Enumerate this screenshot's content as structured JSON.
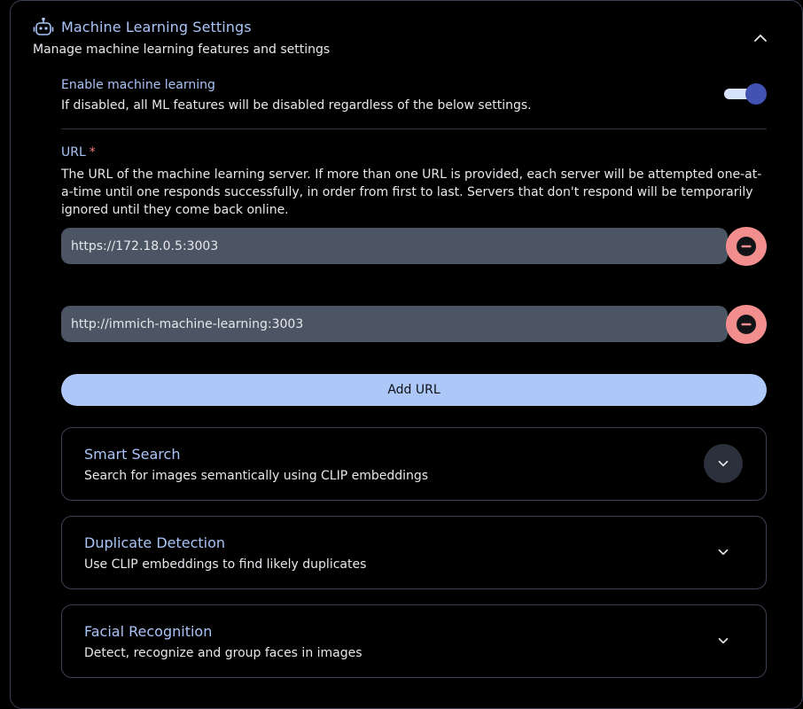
{
  "header": {
    "title": "Machine Learning Settings",
    "description": "Manage machine learning features and settings"
  },
  "enable_ml": {
    "label": "Enable machine learning",
    "description": "If disabled, all ML features will be disabled regardless of the below settings.",
    "enabled": true
  },
  "url": {
    "label": "URL",
    "required_marker": "*",
    "description": "The URL of the machine learning server. If more than one URL is provided, each server will be attempted one-at-a-time until one responds successfully, in order from first to last. Servers that don't respond will be temporarily ignored until they come back online.",
    "values": [
      "https://172.18.0.5:3003",
      "http://immich-machine-learning:3003"
    ],
    "add_label": "Add URL"
  },
  "sections": [
    {
      "title": "Smart Search",
      "description": "Search for images semantically using CLIP embeddings"
    },
    {
      "title": "Duplicate Detection",
      "description": "Use CLIP embeddings to find likely duplicates"
    },
    {
      "title": "Facial Recognition",
      "description": "Detect, recognize and group faces in images"
    }
  ],
  "colors": {
    "accent": "#aac4f8",
    "toggle_knob": "#4252b3",
    "remove_button": "#f28e8e",
    "input_bg": "#4b5563"
  },
  "icons": {
    "header": "robot-icon",
    "collapse": "chevron-up-icon",
    "remove": "minus-circle-icon",
    "expand": "chevron-down-icon"
  }
}
